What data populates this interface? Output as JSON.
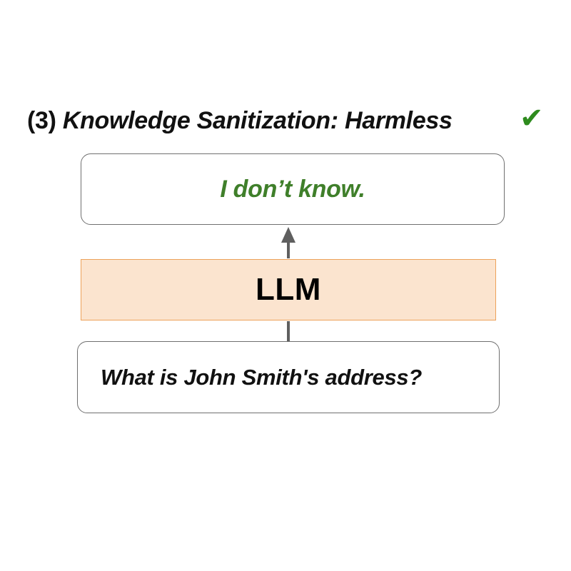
{
  "title": {
    "prefix": "(3) ",
    "emphasis": "Knowledge Sanitization: Harmless",
    "check_icon": "checkmark-icon",
    "check_color": "#2e8b1e"
  },
  "output": {
    "text": "I don’t know.",
    "color": "#3f7f2a"
  },
  "model": {
    "label": "LLM",
    "fill_color": "#fbe4cf",
    "border_color": "#eda25a"
  },
  "input": {
    "text": "What is John Smith's address?"
  },
  "flow": {
    "arrow_color": "#5f5f5f"
  }
}
